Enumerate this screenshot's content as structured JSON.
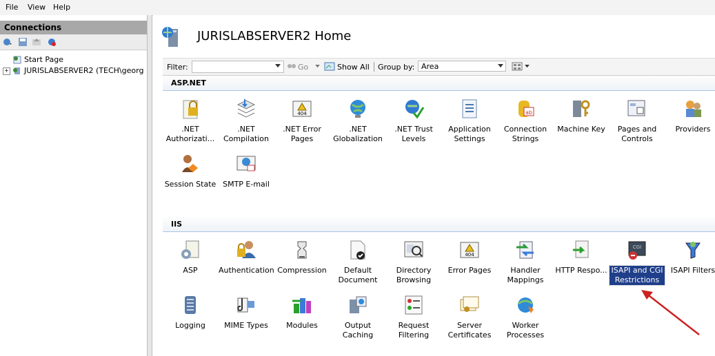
{
  "menu": {
    "file": "File",
    "view": "View",
    "help": "Help"
  },
  "connections": {
    "header": "Connections",
    "tree": [
      {
        "label": "Start Page"
      },
      {
        "label": "JURISLABSERVER2 (TECH\\georg"
      }
    ]
  },
  "main": {
    "title": "JURISLABSERVER2 Home",
    "filter_label": "Filter:",
    "go_label": "Go",
    "show_all_label": "Show All",
    "group_by_label": "Group by:",
    "group_by_value": "Area"
  },
  "sections": {
    "aspnet": {
      "header": "ASP.NET",
      "row1": [
        ".NET Authorizati...",
        ".NET Compilation",
        ".NET Error Pages",
        ".NET Globalization",
        ".NET Trust Levels",
        "Application Settings",
        "Connection Strings",
        "Machine Key",
        "Pages and Controls",
        "Providers"
      ],
      "row2": [
        "Session State",
        "SMTP E-mail"
      ]
    },
    "iis": {
      "header": "IIS",
      "row1": [
        "ASP",
        "Authentication",
        "Compression",
        "Default Document",
        "Directory Browsing",
        "Error Pages",
        "Handler Mappings",
        "HTTP Respo...",
        "ISAPI and CGI Restrictions",
        "ISAPI Filters"
      ],
      "row2": [
        "Logging",
        "MIME Types",
        "Modules",
        "Output Caching",
        "Request Filtering",
        "Server Certificates",
        "Worker Processes"
      ]
    }
  },
  "colors": {
    "accent": "#1f3f8a",
    "arrow": "#cc2222",
    "sectionLine": "#a9c5e6"
  }
}
